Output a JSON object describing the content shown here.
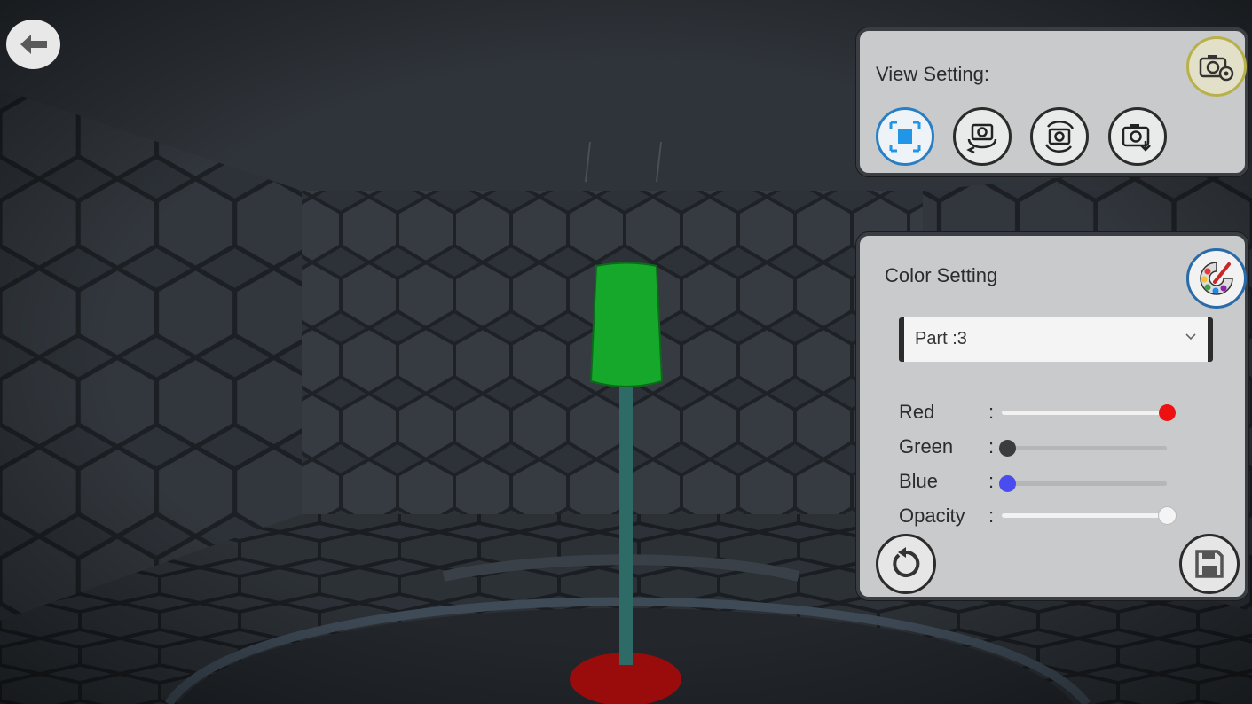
{
  "view_setting": {
    "title": "View Setting:",
    "buttons": [
      "fit-view-icon",
      "rotate-horizontal-icon",
      "rotate-vertical-icon",
      "screenshot-icon"
    ],
    "settings_icon": "camera-settings-icon"
  },
  "color_setting": {
    "title": "Color Setting",
    "palette_icon": "palette-icon",
    "part_select": {
      "value": "Part :3"
    },
    "sliders": [
      {
        "label": "Red",
        "colon": ":",
        "value": 1.0,
        "knob_color": "#ee1111"
      },
      {
        "label": "Green",
        "colon": ":",
        "value": 0.03,
        "knob_color": "#3c3c3c"
      },
      {
        "label": "Blue",
        "colon": ":",
        "value": 0.03,
        "knob_color": "#4a4cf0"
      },
      {
        "label": "Opacity",
        "colon": ":",
        "value": 1.0,
        "knob_color": "#f4f4f4"
      }
    ],
    "reset_icon": "reset-icon",
    "save_icon": "save-icon"
  },
  "back_icon": "back-arrow-icon",
  "colors": {
    "model_green": "#15a82b",
    "model_rod": "#2f6b66",
    "model_base": "#9a0b0b",
    "panel_bg": "#c9cacc",
    "scene_bg": "#2b3036"
  }
}
